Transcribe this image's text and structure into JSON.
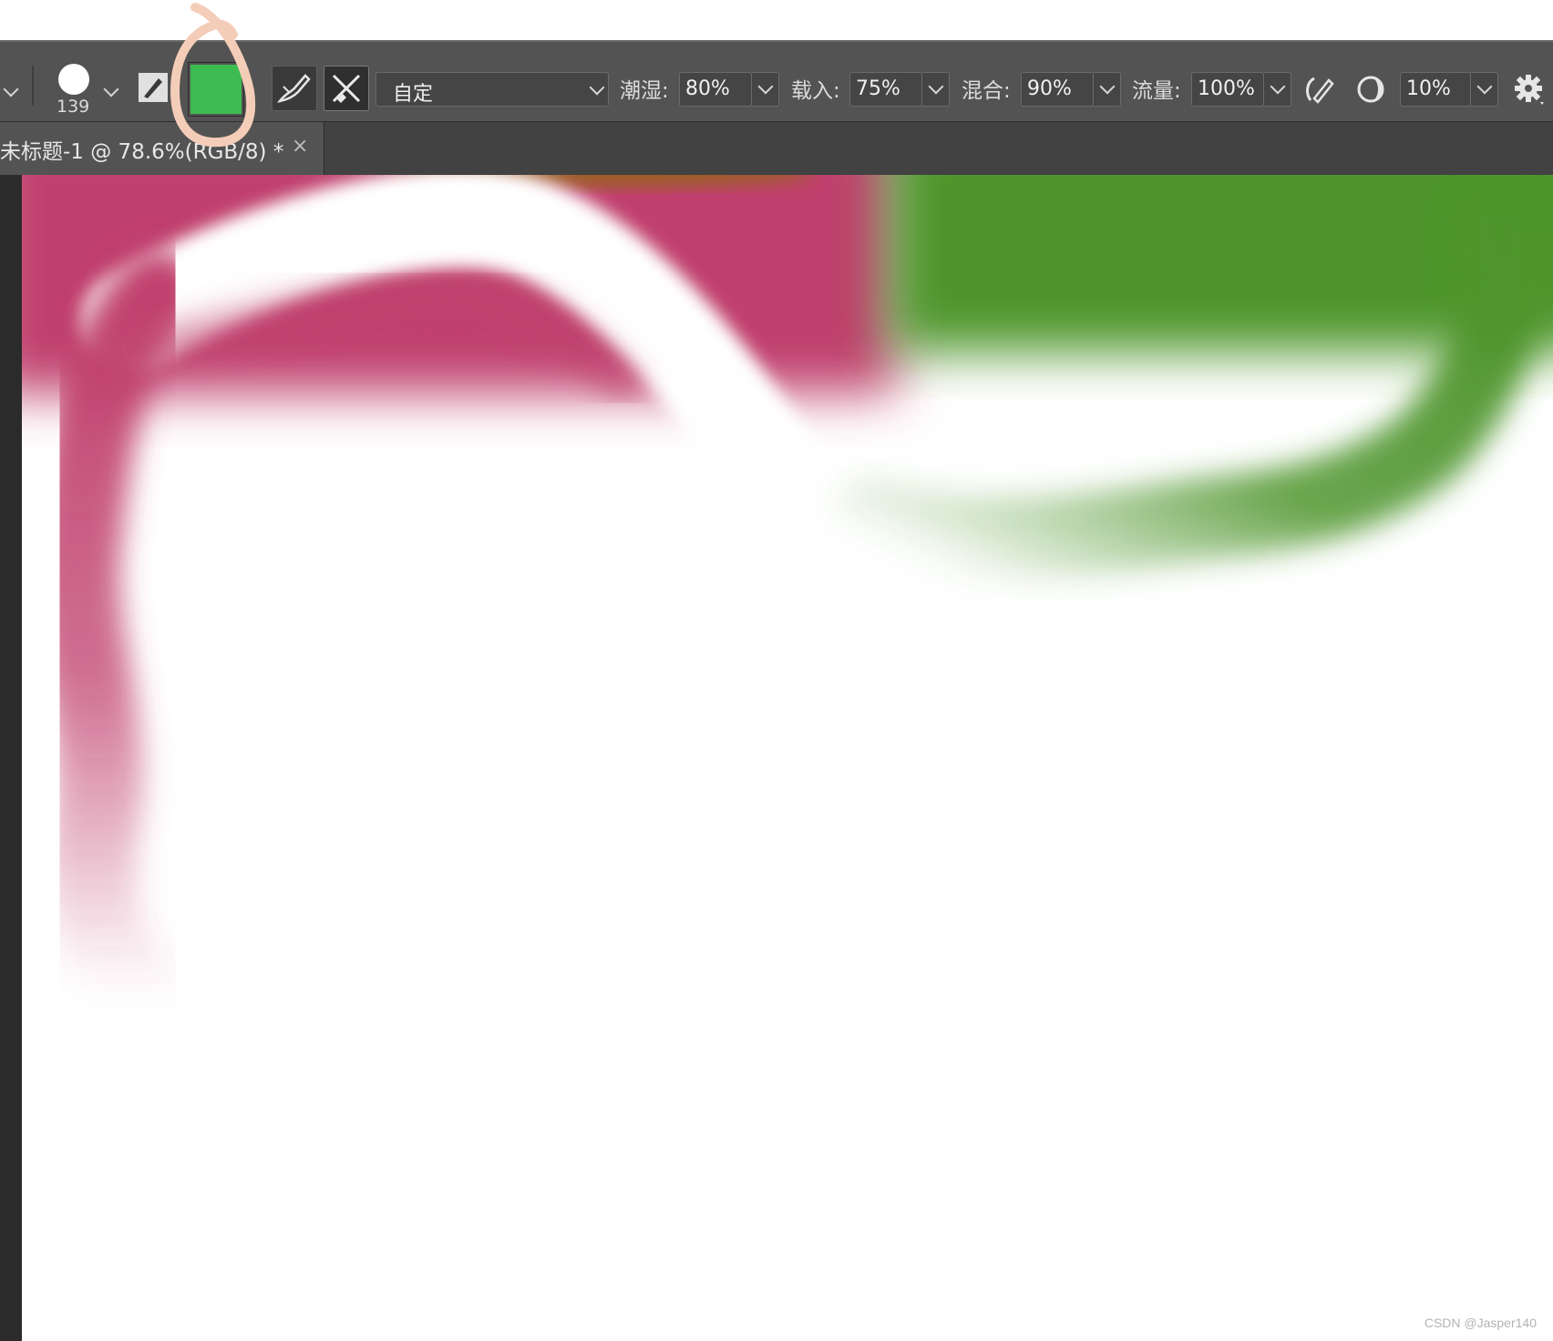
{
  "options_bar": {
    "brush_size": "139",
    "color_swatch": "#3cbc50",
    "preset": "自定",
    "wet_label": "潮湿:",
    "wet_value": "80%",
    "load_label": "载入:",
    "load_value": "75%",
    "mix_label": "混合:",
    "mix_value": "90%",
    "flow_label": "流量:",
    "flow_value": "100%",
    "smoothing_value": "10%",
    "icons": [
      "chevron-down-icon",
      "brush-tip-icon",
      "brush-load-icon",
      "color-swatch",
      "clean-brush-icon",
      "mix-brush-icon",
      "airbrush-icon",
      "pressure-icon",
      "gear-icon"
    ]
  },
  "document_tab": {
    "title": "未标题-1 @ 78.6%(RGB/8) *",
    "close_label": "×"
  },
  "canvas": {
    "stroke_colors": [
      "#c0416d",
      "#4e952c",
      "#9b5f28"
    ]
  },
  "annotation": {
    "color": "#f4cdb8"
  },
  "watermark": "CSDN @Jasper140"
}
